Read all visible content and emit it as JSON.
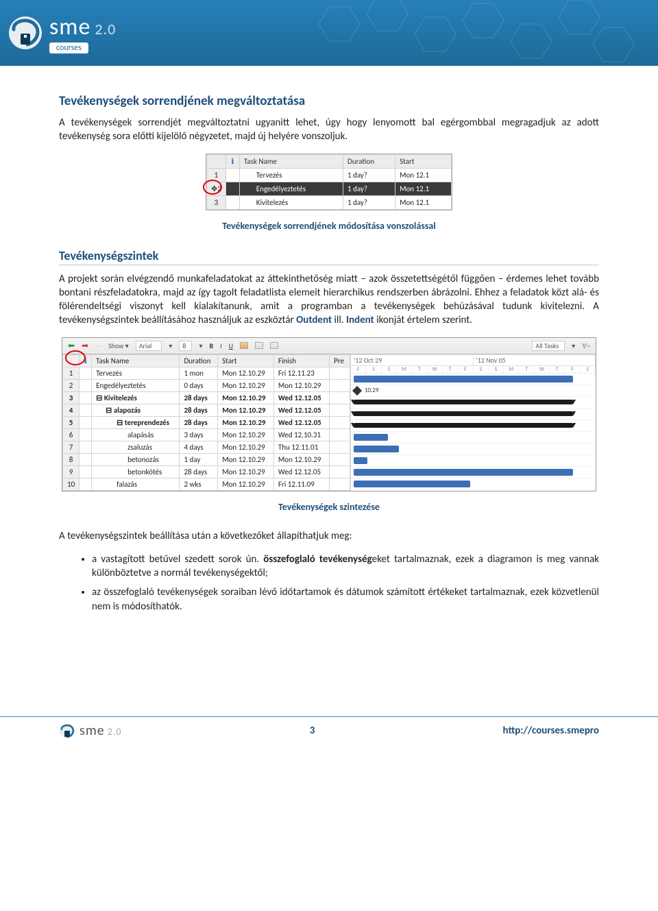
{
  "banner": {
    "logo_text": "sme",
    "logo_suffix": "2.0",
    "logo_sub": "courses"
  },
  "section1": {
    "title": "Tevékenységek sorrendjének megváltoztatása",
    "body": "A tevékenységek sorrendjét megváltoztatni ugyanitt lehet, úgy hogy lenyomott bal egérgombbal megragadjuk az adott tevékenység sora előtti kijelölő négyzetet, majd új helyére vonszoljuk."
  },
  "figure1": {
    "headers": {
      "info": "",
      "task": "Task Name",
      "duration": "Duration",
      "start": "Start"
    },
    "rows": [
      {
        "n": "1",
        "name": "Tervezés",
        "dur": "1 day?",
        "start": "Mon 12.1"
      },
      {
        "n": "2",
        "name": "Engedélyeztetés",
        "dur": "1 day?",
        "start": "Mon 12.1",
        "selected": true
      },
      {
        "n": "3",
        "name": "Kivitelezés",
        "dur": "1 day?",
        "start": "Mon 12.1"
      }
    ],
    "caption": "Tevékenységek sorrendjének módosítása vonszolással"
  },
  "section2": {
    "title": "Tevékenységszintek",
    "body_parts": {
      "p1": "A projekt során elvégzendő munkafeladatokat az áttekinthetőség miatt – azok összetettségétől függően – érdemes lehet tovább bontani részfeladatokra, majd az így tagolt feladatlista elemeit hierarchikus rendszerben ábrázolni. Ehhez a feladatok közt alá- és fölérendeltségi viszonyt kell kialakítanunk, amit a programban a tevékenységek behúzásával tudunk kivitelezni. A tevékenységszintek beállításához használjuk az eszköztár ",
      "outdent": "Outdent",
      "p2": " ill. ",
      "indent": "Indent",
      "p3": " ikonját értelem szerint."
    }
  },
  "figure2": {
    "toolbar": {
      "show": "Show",
      "font": "Arial",
      "size": "8",
      "filter": "All Tasks"
    },
    "headers": {
      "info": "",
      "task": "Task Name",
      "duration": "Duration",
      "start": "Start",
      "finish": "Finish",
      "pre": "Pre"
    },
    "dates": [
      "'12 Oct 29",
      "'12 Nov 05"
    ],
    "days": [
      "F",
      "S",
      "S",
      "M",
      "T",
      "W",
      "T",
      "F",
      "S",
      "S",
      "M",
      "T",
      "W",
      "T",
      "F",
      "S"
    ],
    "rows": [
      {
        "n": "1",
        "name": "Tervezés",
        "dur": "1 mon",
        "start": "Mon 12.10.29",
        "finish": "Fri 12.11.23",
        "indent": 0,
        "bold": false,
        "type": "task",
        "bx": 4,
        "bw": 320
      },
      {
        "n": "2",
        "name": "Engedélyeztetés",
        "dur": "0 days",
        "start": "Mon 12.10.29",
        "finish": "Mon 12.10.29",
        "indent": 0,
        "bold": false,
        "type": "milestone",
        "bx": 4,
        "label": "10.29"
      },
      {
        "n": "3",
        "name": "Kivitelezés",
        "dur": "28 days",
        "start": "Mon 12.10.29",
        "finish": "Wed 12.12.05",
        "indent": 0,
        "bold": true,
        "type": "sum",
        "bx": 4,
        "bw": 320
      },
      {
        "n": "4",
        "name": "alapozás",
        "dur": "28 days",
        "start": "Mon 12.10.29",
        "finish": "Wed 12.12.05",
        "indent": 1,
        "bold": true,
        "type": "sum",
        "bx": 4,
        "bw": 320
      },
      {
        "n": "5",
        "name": "tereprendezés",
        "dur": "28 days",
        "start": "Mon 12.10.29",
        "finish": "Wed 12.12.05",
        "indent": 2,
        "bold": true,
        "type": "sum",
        "bx": 4,
        "bw": 320
      },
      {
        "n": "6",
        "name": "alapásás",
        "dur": "3 days",
        "start": "Mon 12.10.29",
        "finish": "Wed 12.10.31",
        "indent": 3,
        "bold": false,
        "type": "task",
        "bx": 4,
        "bw": 50
      },
      {
        "n": "7",
        "name": "zsaluzás",
        "dur": "4 days",
        "start": "Mon 12.10.29",
        "finish": "Thu 12.11.01",
        "indent": 3,
        "bold": false,
        "type": "task",
        "bx": 4,
        "bw": 66
      },
      {
        "n": "8",
        "name": "betonozás",
        "dur": "1 day",
        "start": "Mon 12.10.29",
        "finish": "Mon 12.10.29",
        "indent": 3,
        "bold": false,
        "type": "task",
        "bx": 4,
        "bw": 20
      },
      {
        "n": "9",
        "name": "betonkötés",
        "dur": "28 days",
        "start": "Mon 12.10.29",
        "finish": "Wed 12.12.05",
        "indent": 3,
        "bold": false,
        "type": "task",
        "bx": 4,
        "bw": 320
      },
      {
        "n": "10",
        "name": "falazás",
        "dur": "2 wks",
        "start": "Mon 12.10.29",
        "finish": "Fri 12.11.09",
        "indent": 2,
        "bold": false,
        "type": "task",
        "bx": 4,
        "bw": 170
      }
    ],
    "caption": "Tevékenységek szintezése"
  },
  "section3": {
    "body": "A tevékenységszintek beállítása után a következőket állapíthatjuk meg:",
    "bullets": [
      {
        "pre": "a vastagított betűvel szedett sorok ún. ",
        "bold": "összefoglaló tevékenység",
        "post": "eket tartalmaznak, ezek a diagramon is meg vannak különböztetve a normál tevékenységektől;"
      },
      {
        "pre": "az összefoglaló tevékenységek soraiban lévő időtartamok és dátumok számított értékeket tartalmaznak, ezek közvetlenül nem is módosíthatók.",
        "bold": "",
        "post": ""
      }
    ]
  },
  "footer": {
    "page": "3",
    "url": "http://courses.smepro",
    "logo_text": "sme",
    "logo_suffix": "2.0"
  }
}
